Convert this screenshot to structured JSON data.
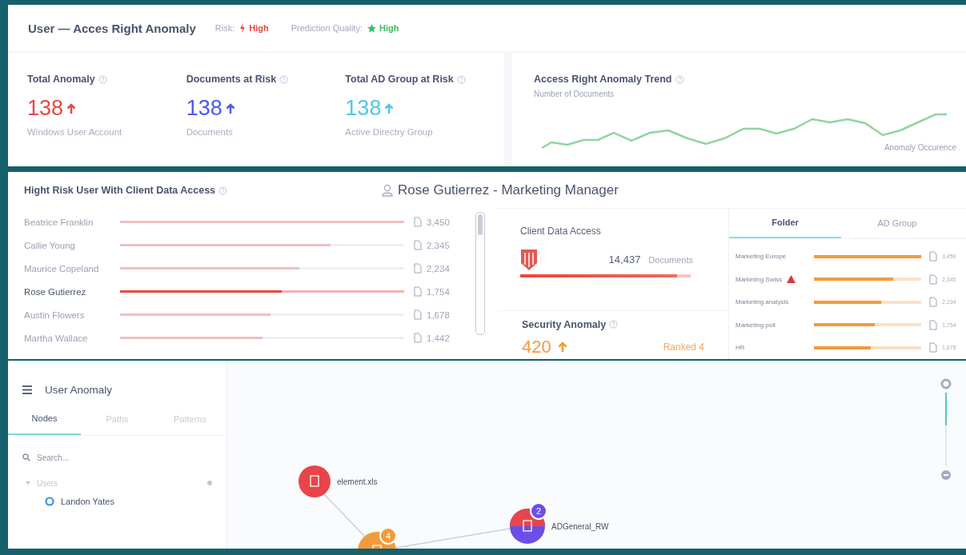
{
  "header": {
    "title": "User — Acces Right Anomaly",
    "risk": {
      "label": "Risk:",
      "value": "High"
    },
    "quality": {
      "label": "Prediction Quality:",
      "value": "High"
    }
  },
  "stats": [
    {
      "title": "Total Anomaly",
      "value": "138",
      "caption": "Windows User Account",
      "color": "#e8483f"
    },
    {
      "title": "Documents at Risk",
      "value": "138",
      "caption": "Documents",
      "color": "#4b59f0"
    },
    {
      "title": "Total AD Group at Risk",
      "value": "138",
      "caption": "Active Directry Group",
      "color": "#4fc8e6"
    }
  ],
  "trend": {
    "title": "Access Right Anomaly Trend",
    "y_axis_label": "Number of Documents",
    "x_axis_label": "Anomaly Occurence"
  },
  "risk_users": {
    "title": "Hight Risk User With Client Data Access",
    "rows": [
      {
        "name": "Beatrice Franklin",
        "level": 1,
        "count": "3,450",
        "selected": false
      },
      {
        "name": "Callie Young",
        "level": 0.74,
        "count": "2,345",
        "selected": false
      },
      {
        "name": "Maurice Copeland",
        "level": 0.63,
        "count": "2,234",
        "selected": false
      },
      {
        "name": "Rose Gutierrez",
        "level": 0.57,
        "count": "1,754",
        "selected": true
      },
      {
        "name": "Austin Flowers",
        "level": 0.53,
        "count": "1,678",
        "selected": false
      },
      {
        "name": "Martha Wallace",
        "level": 0.5,
        "count": "1,442",
        "selected": false
      }
    ]
  },
  "profile": {
    "name": "Rose Gutierrez - Marketing Manager"
  },
  "client_data": {
    "title": "Client Data Access",
    "count": "14,437",
    "unit": "Documents",
    "level": 0.92
  },
  "security": {
    "title": "Security Anomaly",
    "value": "420",
    "rank": "Ranked 4"
  },
  "folder_tabs": [
    {
      "label": "Folder",
      "selected": true
    },
    {
      "label": "AD Group",
      "selected": false
    }
  ],
  "folders": [
    {
      "name": "Marketing Europe",
      "warning": false,
      "level": 1,
      "count": "3,450"
    },
    {
      "name": "Marketing Swiss",
      "warning": true,
      "level": 0.74,
      "count": "2,345"
    },
    {
      "name": "Marketing analysis",
      "warning": false,
      "level": 0.63,
      "count": "2,234"
    },
    {
      "name": "Marketing poll",
      "warning": false,
      "level": 0.57,
      "count": "1,754"
    },
    {
      "name": "HR",
      "warning": false,
      "level": 0.53,
      "count": "1,678"
    }
  ],
  "anomaly_panel": {
    "title": "User Anomaly",
    "tabs": [
      {
        "label": "Nodes",
        "selected": true
      },
      {
        "label": "Paths",
        "selected": false
      },
      {
        "label": "Patterns",
        "selected": false
      }
    ],
    "search": {
      "placeholder": "Search..."
    },
    "tree": [
      {
        "label": "Users",
        "expanded": true,
        "children": [
          {
            "label": "Landon Yates"
          }
        ]
      }
    ]
  },
  "graph": {
    "nodes": [
      {
        "kind": "file",
        "label": "element.xls"
      },
      {
        "kind": "share",
        "badge": "4"
      },
      {
        "kind": "group",
        "label": "ADGeneral_RW",
        "badge": "2"
      }
    ]
  },
  "zoom": {
    "level": 0.45
  }
}
